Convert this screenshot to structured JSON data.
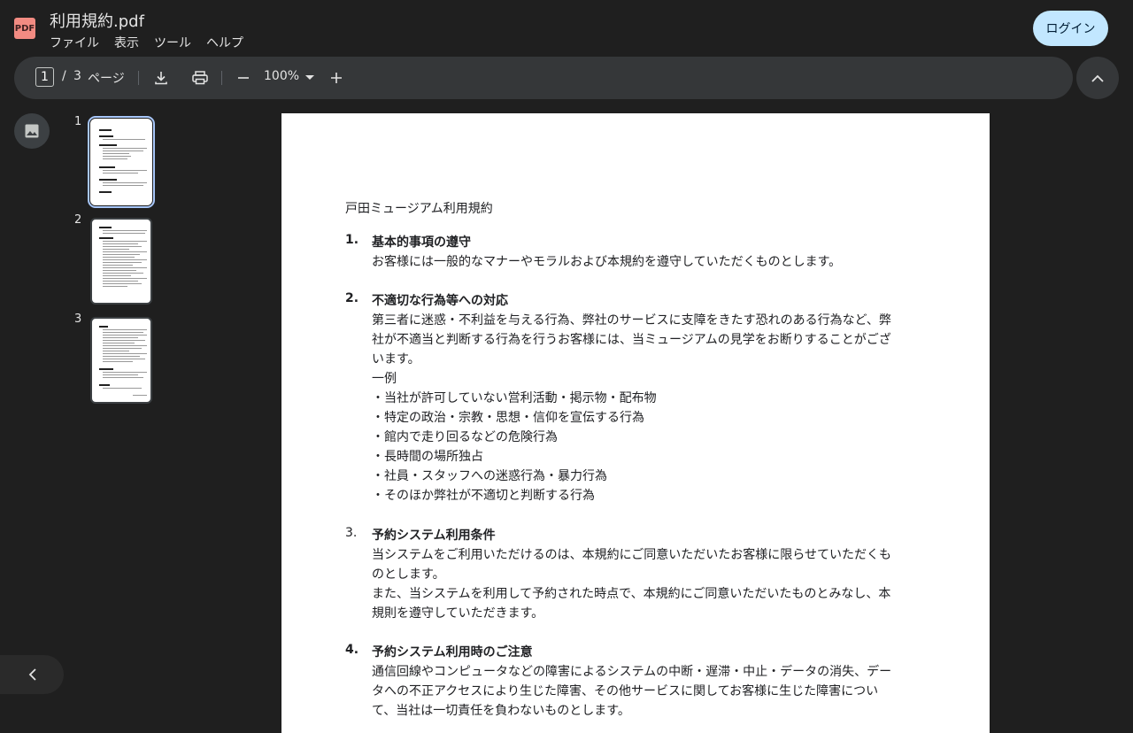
{
  "title_bar": {
    "badge": "PDF",
    "file_name": "利用規約.pdf",
    "menus": [
      "ファイル",
      "表示",
      "ツール",
      "ヘルプ"
    ],
    "login_label": "ログイン"
  },
  "toolbar": {
    "current_page": "1",
    "separator": "/",
    "total_pages": "3",
    "page_unit": "ページ",
    "zoom": "100%"
  },
  "thumbnails": [
    "1",
    "2",
    "3"
  ],
  "document": {
    "heading": "戸田ミュージアム利用規約",
    "sections": [
      {
        "num": "1.",
        "title": "基本的事項の遵守",
        "lines": [
          "お客様には一般的なマナーやモラルおよび本規約を遵守していただくものとします。"
        ]
      },
      {
        "num": "2.",
        "title": "不適切な行為等への対応",
        "lines": [
          "第三者に迷惑・不利益を与える行為、弊社のサービスに支障をきたす恐れのある行為など、弊",
          "社が不適当と判断する行為を行うお客様には、当ミュージアムの見学をお断りすることがござ",
          "います。",
          "一例",
          "・当社が許可していない営利活動・掲示物・配布物",
          "・特定の政治・宗教・思想・信仰を宣伝する行為",
          "・館内で走り回るなどの危険行為",
          "・長時間の場所独占",
          "・社員・スタッフへの迷惑行為・暴力行為",
          "・そのほか弊社が不適切と判断する行為"
        ]
      },
      {
        "num": "3.",
        "title": "予約システム利用条件",
        "lines": [
          "当システムをご利用いただけるのは、本規約にご同意いただいたお客様に限らせていただくも",
          "のとします。",
          "また、当システムを利用して予約された時点で、本規約にご同意いただいたものとみなし、本",
          "規則を遵守していただきます。"
        ]
      },
      {
        "num": "4.",
        "title": "予約システム利用時のご注意",
        "lines": [
          "通信回線やコンピュータなどの障害によるシステムの中断・遅滞・中止・データの消失、デー",
          "タへの不正アクセスにより生じた障害、その他サービスに関してお客様に生じた障害につい",
          "て、当社は一切責任を負わないものとします。"
        ]
      }
    ]
  }
}
